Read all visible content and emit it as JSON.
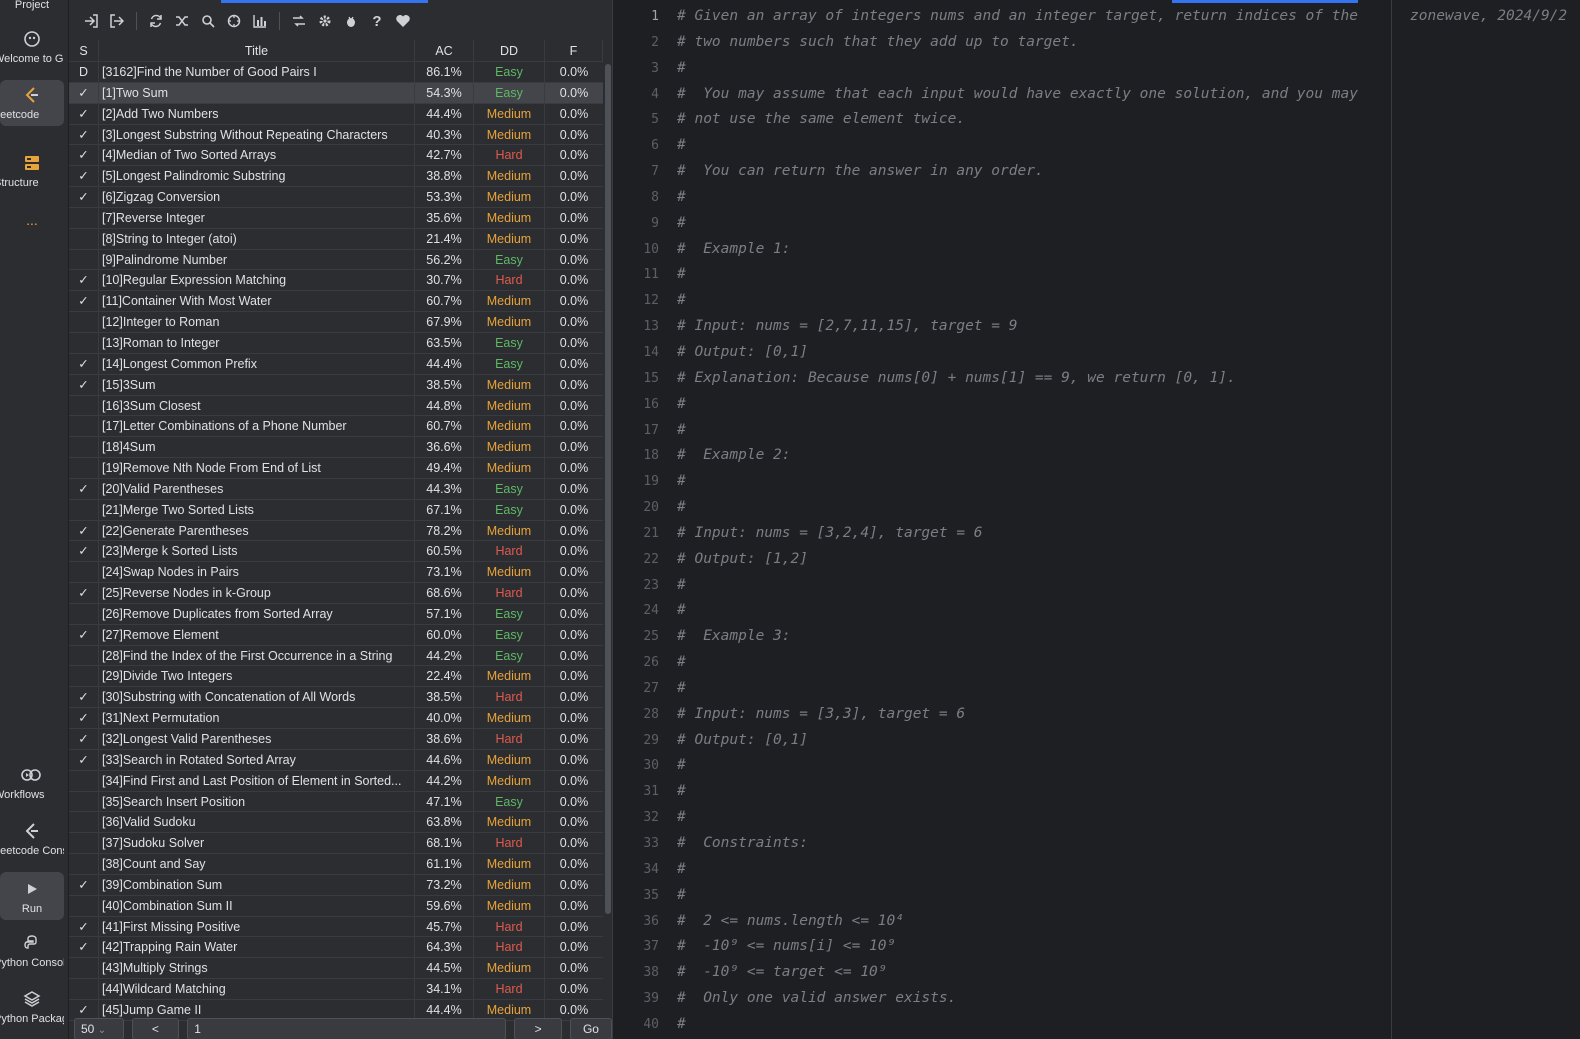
{
  "sidebar": {
    "project_label": "Project",
    "items": [
      {
        "icon": "github-icon",
        "label": "Welcome to GitHub"
      },
      {
        "icon": "leetcode-icon",
        "label": "Leetcode"
      },
      {
        "icon": "structure-icon",
        "label": "Structure"
      },
      {
        "icon": "more-icon",
        "label": "..."
      },
      {
        "icon": "workflows-icon",
        "label": "Workflows"
      },
      {
        "icon": "leetcode-console-icon",
        "label": "Leetcode Console"
      },
      {
        "icon": "run-icon",
        "label": "Run"
      },
      {
        "icon": "python-console-icon",
        "label": "Python Console"
      },
      {
        "icon": "python-packages-icon",
        "label": "Python Packages"
      }
    ]
  },
  "toolbar": {
    "icons": [
      "login-icon",
      "logout-icon",
      "refresh-icon",
      "random-icon",
      "search-icon",
      "find-icon",
      "chart-icon",
      "sort-icon",
      "settings-icon",
      "bug-icon",
      "help-icon",
      "favorite-icon"
    ]
  },
  "table": {
    "headers": {
      "s": "S",
      "title": "Title",
      "ac": "AC",
      "dd": "DD",
      "f": "F"
    },
    "rows": [
      {
        "s": "D",
        "title": "[3162]Find the Number of Good Pairs I",
        "ac": "86.1%",
        "dd": "Easy",
        "f": "0.0%"
      },
      {
        "s": "✓",
        "title": "[1]Two Sum",
        "ac": "54.3%",
        "dd": "Easy",
        "f": "0.0%"
      },
      {
        "s": "✓",
        "title": "[2]Add Two Numbers",
        "ac": "44.4%",
        "dd": "Medium",
        "f": "0.0%"
      },
      {
        "s": "✓",
        "title": "[3]Longest Substring Without Repeating Characters",
        "ac": "40.3%",
        "dd": "Medium",
        "f": "0.0%"
      },
      {
        "s": "✓",
        "title": "[4]Median of Two Sorted Arrays",
        "ac": "42.7%",
        "dd": "Hard",
        "f": "0.0%"
      },
      {
        "s": "✓",
        "title": "[5]Longest Palindromic Substring",
        "ac": "38.8%",
        "dd": "Medium",
        "f": "0.0%"
      },
      {
        "s": "✓",
        "title": "[6]Zigzag Conversion",
        "ac": "53.3%",
        "dd": "Medium",
        "f": "0.0%"
      },
      {
        "s": "",
        "title": "[7]Reverse Integer",
        "ac": "35.6%",
        "dd": "Medium",
        "f": "0.0%"
      },
      {
        "s": "",
        "title": "[8]String to Integer (atoi)",
        "ac": "21.4%",
        "dd": "Medium",
        "f": "0.0%"
      },
      {
        "s": "",
        "title": "[9]Palindrome Number",
        "ac": "56.2%",
        "dd": "Easy",
        "f": "0.0%"
      },
      {
        "s": "✓",
        "title": "[10]Regular Expression Matching",
        "ac": "30.7%",
        "dd": "Hard",
        "f": "0.0%"
      },
      {
        "s": "✓",
        "title": "[11]Container With Most Water",
        "ac": "60.7%",
        "dd": "Medium",
        "f": "0.0%"
      },
      {
        "s": "",
        "title": "[12]Integer to Roman",
        "ac": "67.9%",
        "dd": "Medium",
        "f": "0.0%"
      },
      {
        "s": "",
        "title": "[13]Roman to Integer",
        "ac": "63.5%",
        "dd": "Easy",
        "f": "0.0%"
      },
      {
        "s": "✓",
        "title": "[14]Longest Common Prefix",
        "ac": "44.4%",
        "dd": "Easy",
        "f": "0.0%"
      },
      {
        "s": "✓",
        "title": "[15]3Sum",
        "ac": "38.5%",
        "dd": "Medium",
        "f": "0.0%"
      },
      {
        "s": "",
        "title": "[16]3Sum Closest",
        "ac": "44.8%",
        "dd": "Medium",
        "f": "0.0%"
      },
      {
        "s": "",
        "title": "[17]Letter Combinations of a Phone Number",
        "ac": "60.7%",
        "dd": "Medium",
        "f": "0.0%"
      },
      {
        "s": "",
        "title": "[18]4Sum",
        "ac": "36.6%",
        "dd": "Medium",
        "f": "0.0%"
      },
      {
        "s": "",
        "title": "[19]Remove Nth Node From End of List",
        "ac": "49.4%",
        "dd": "Medium",
        "f": "0.0%"
      },
      {
        "s": "✓",
        "title": "[20]Valid Parentheses",
        "ac": "44.3%",
        "dd": "Easy",
        "f": "0.0%"
      },
      {
        "s": "",
        "title": "[21]Merge Two Sorted Lists",
        "ac": "67.1%",
        "dd": "Easy",
        "f": "0.0%"
      },
      {
        "s": "✓",
        "title": "[22]Generate Parentheses",
        "ac": "78.2%",
        "dd": "Medium",
        "f": "0.0%"
      },
      {
        "s": "✓",
        "title": "[23]Merge k Sorted Lists",
        "ac": "60.5%",
        "dd": "Hard",
        "f": "0.0%"
      },
      {
        "s": "",
        "title": "[24]Swap Nodes in Pairs",
        "ac": "73.1%",
        "dd": "Medium",
        "f": "0.0%"
      },
      {
        "s": "✓",
        "title": "[25]Reverse Nodes in k-Group",
        "ac": "68.6%",
        "dd": "Hard",
        "f": "0.0%"
      },
      {
        "s": "",
        "title": "[26]Remove Duplicates from Sorted Array",
        "ac": "57.1%",
        "dd": "Easy",
        "f": "0.0%"
      },
      {
        "s": "✓",
        "title": "[27]Remove Element",
        "ac": "60.0%",
        "dd": "Easy",
        "f": "0.0%"
      },
      {
        "s": "",
        "title": "[28]Find the Index of the First Occurrence in a String",
        "ac": "44.2%",
        "dd": "Easy",
        "f": "0.0%"
      },
      {
        "s": "",
        "title": "[29]Divide Two Integers",
        "ac": "22.4%",
        "dd": "Medium",
        "f": "0.0%"
      },
      {
        "s": "✓",
        "title": "[30]Substring with Concatenation of All Words",
        "ac": "38.5%",
        "dd": "Hard",
        "f": "0.0%"
      },
      {
        "s": "✓",
        "title": "[31]Next Permutation",
        "ac": "40.0%",
        "dd": "Medium",
        "f": "0.0%"
      },
      {
        "s": "✓",
        "title": "[32]Longest Valid Parentheses",
        "ac": "38.6%",
        "dd": "Hard",
        "f": "0.0%"
      },
      {
        "s": "✓",
        "title": "[33]Search in Rotated Sorted Array",
        "ac": "44.6%",
        "dd": "Medium",
        "f": "0.0%"
      },
      {
        "s": "",
        "title": "[34]Find First and Last Position of Element in Sorted...",
        "ac": "44.2%",
        "dd": "Medium",
        "f": "0.0%"
      },
      {
        "s": "",
        "title": "[35]Search Insert Position",
        "ac": "47.1%",
        "dd": "Easy",
        "f": "0.0%"
      },
      {
        "s": "",
        "title": "[36]Valid Sudoku",
        "ac": "63.8%",
        "dd": "Medium",
        "f": "0.0%"
      },
      {
        "s": "",
        "title": "[37]Sudoku Solver",
        "ac": "68.1%",
        "dd": "Hard",
        "f": "0.0%"
      },
      {
        "s": "",
        "title": "[38]Count and Say",
        "ac": "61.1%",
        "dd": "Medium",
        "f": "0.0%"
      },
      {
        "s": "✓",
        "title": "[39]Combination Sum",
        "ac": "73.2%",
        "dd": "Medium",
        "f": "0.0%"
      },
      {
        "s": "",
        "title": "[40]Combination Sum II",
        "ac": "59.6%",
        "dd": "Medium",
        "f": "0.0%"
      },
      {
        "s": "✓",
        "title": "[41]First Missing Positive",
        "ac": "45.7%",
        "dd": "Hard",
        "f": "0.0%"
      },
      {
        "s": "✓",
        "title": "[42]Trapping Rain Water",
        "ac": "64.3%",
        "dd": "Hard",
        "f": "0.0%"
      },
      {
        "s": "",
        "title": "[43]Multiply Strings",
        "ac": "44.5%",
        "dd": "Medium",
        "f": "0.0%"
      },
      {
        "s": "",
        "title": "[44]Wildcard Matching",
        "ac": "34.1%",
        "dd": "Hard",
        "f": "0.0%"
      },
      {
        "s": "✓",
        "title": "[45]Jump Game II",
        "ac": "44.4%",
        "dd": "Medium",
        "f": "0.0%"
      }
    ],
    "selected_index": 1
  },
  "pager": {
    "page_size": "50",
    "prev": "<",
    "page": "1",
    "next": ">",
    "go": "Go"
  },
  "editor": {
    "current_line": 1,
    "blame": "zonewave, 2024/9/2",
    "lines": [
      "# Given an array of integers nums and an integer target, return indices of the",
      "# two numbers such that they add up to target.",
      "#",
      "#  You may assume that each input would have exactly one solution, and you may",
      "# not use the same element twice.",
      "#",
      "#  You can return the answer in any order.",
      "#",
      "#",
      "#  Example 1:",
      "#",
      "#",
      "# Input: nums = [2,7,11,15], target = 9",
      "# Output: [0,1]",
      "# Explanation: Because nums[0] + nums[1] == 9, we return [0, 1].",
      "#",
      "#",
      "#  Example 2:",
      "#",
      "#",
      "# Input: nums = [3,2,4], target = 6",
      "# Output: [1,2]",
      "#",
      "#",
      "#  Example 3:",
      "#",
      "#",
      "# Input: nums = [3,3], target = 6",
      "# Output: [0,1]",
      "#",
      "#",
      "#",
      "#  Constraints:",
      "#",
      "#",
      "#  2 <= nums.length <= 10⁴",
      "#  -10⁹ <= nums[i] <= 10⁹",
      "#  -10⁹ <= target <= 10⁹",
      "#  Only one valid answer exists.",
      "#"
    ]
  },
  "colors": {
    "easy": "#5fb865",
    "medium": "#e8a33a",
    "hard": "#e05a4f",
    "accent": "#3574f0"
  }
}
